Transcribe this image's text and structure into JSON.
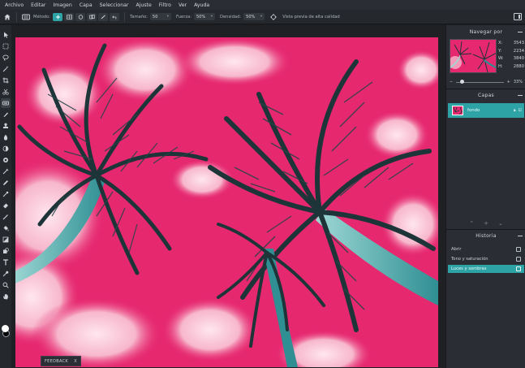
{
  "menu": [
    "Archivo",
    "Editar",
    "Imagen",
    "Capa",
    "Seleccionar",
    "Ajuste",
    "Filtro",
    "Ver",
    "Ayuda"
  ],
  "options": {
    "method_label": "Método:",
    "size_label": "Tamaño:",
    "size_value": "50",
    "strength_label": "Fuerza:",
    "strength_value": "50%",
    "density_label": "Densidad:",
    "density_value": "50%",
    "preview_label": "Vista previa de alta calidad"
  },
  "navigator": {
    "title": "Navegar por",
    "x_label": "X:",
    "x_value": "3543",
    "y_label": "Y:",
    "y_value": "2234",
    "w_label": "W:",
    "w_value": "3840",
    "h_label": "H:",
    "h_value": "2880",
    "zoom_value": "33%",
    "zoom_level": 0.12
  },
  "layers": {
    "title": "Capas",
    "items": [
      {
        "name": "fondo"
      }
    ]
  },
  "history": {
    "title": "Historia",
    "items": [
      {
        "label": "Abrir",
        "active": false
      },
      {
        "label": "Tono y saturación",
        "active": false
      },
      {
        "label": "Luces y sombras",
        "active": true
      }
    ]
  },
  "feedback": {
    "label": "FEEDBACK",
    "close": "X"
  },
  "colors": {
    "accent": "#2ea3a6",
    "canvas_sky": "#e6286f",
    "foreground": "#ffffff",
    "background": "#000000"
  },
  "icons": [
    "home-icon",
    "healing-brush-icon",
    "mode-icons",
    "target-icon",
    "sidebar-toggle-icon"
  ]
}
